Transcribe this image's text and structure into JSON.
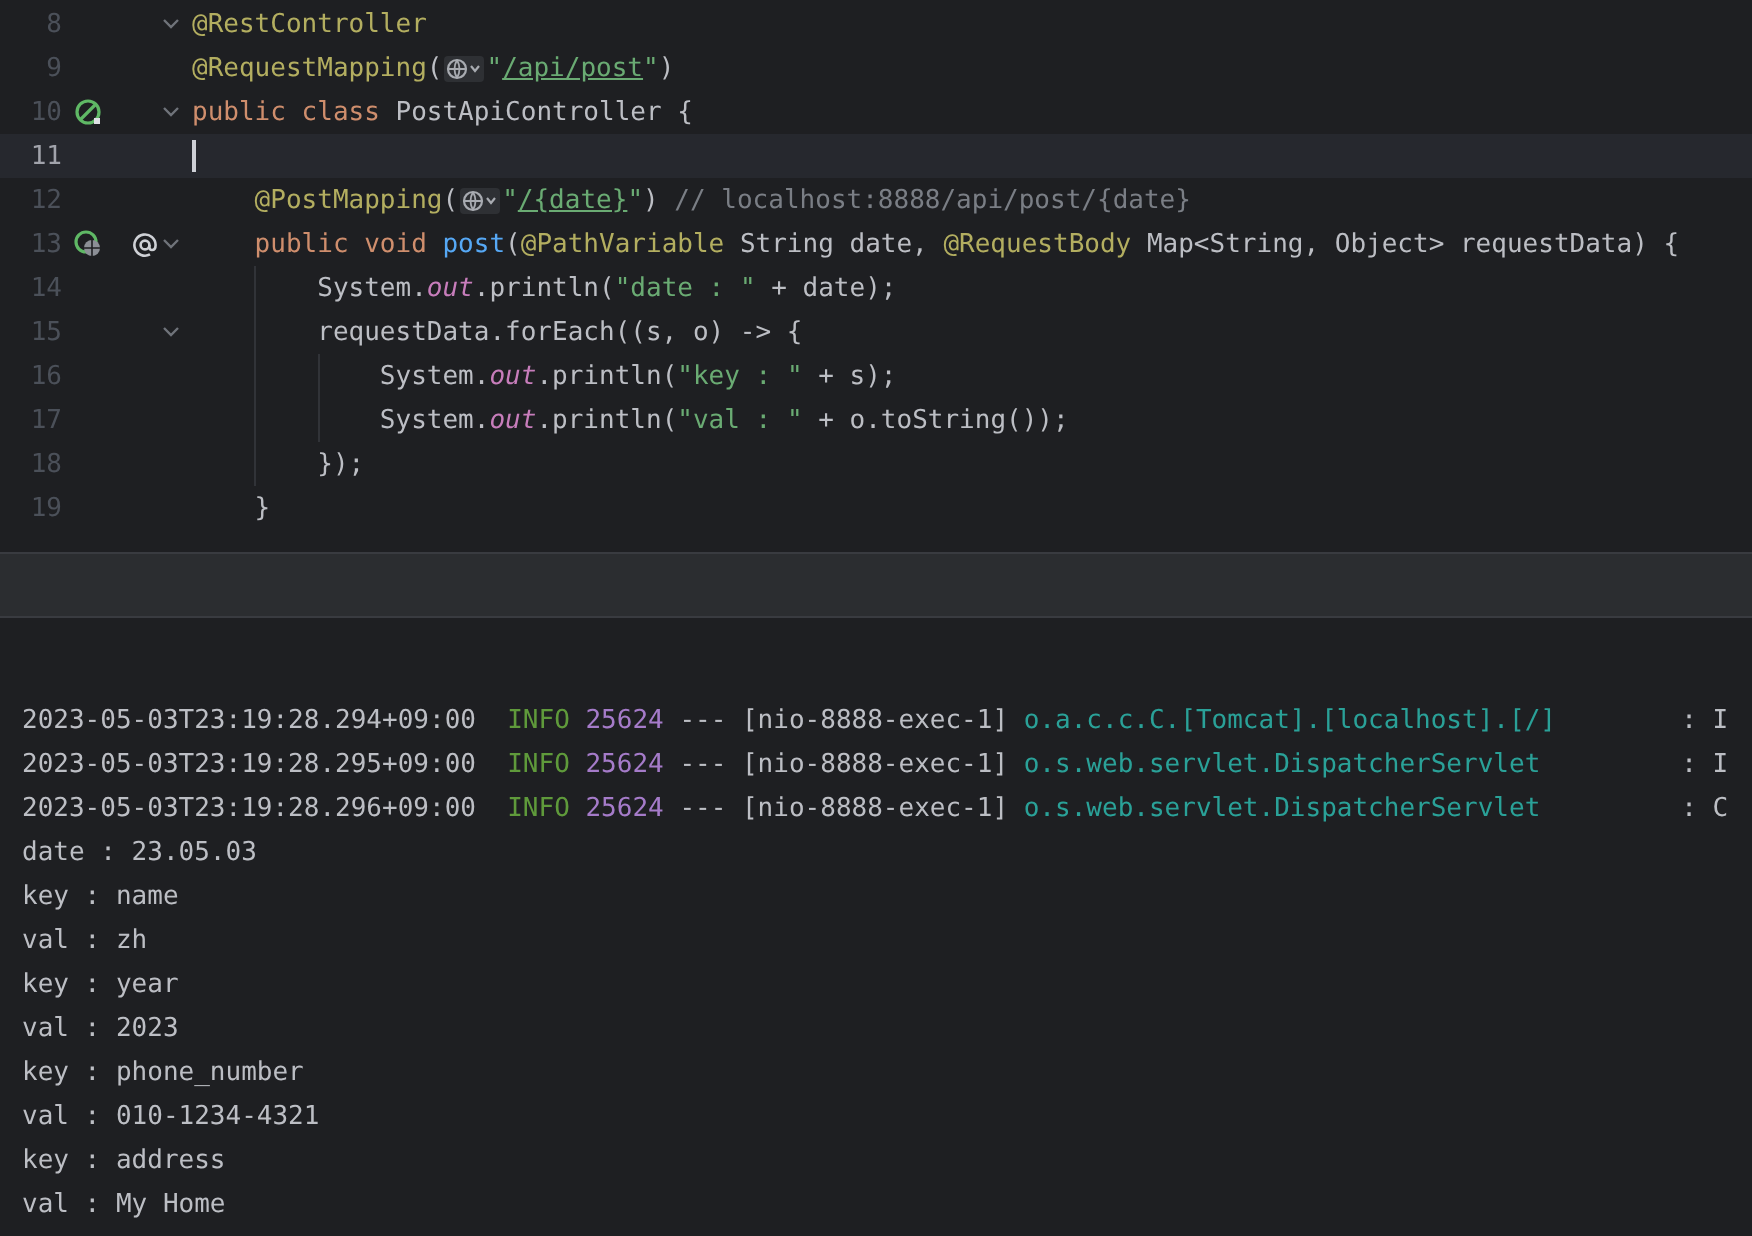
{
  "editor": {
    "lines": [
      {
        "number": "8",
        "current": false,
        "foldable": true,
        "tokens": [
          {
            "kind": "annotation",
            "text": "@RestController"
          }
        ]
      },
      {
        "number": "9",
        "current": false,
        "foldable": false,
        "tokens": [
          {
            "kind": "annotation",
            "text": "@RequestMapping"
          },
          {
            "kind": "plain",
            "text": "("
          },
          {
            "kind": "inlay"
          },
          {
            "kind": "string",
            "text": "\""
          },
          {
            "kind": "url",
            "text": "/api/post"
          },
          {
            "kind": "string",
            "text": "\""
          },
          {
            "kind": "plain",
            "text": ")"
          }
        ]
      },
      {
        "number": "10",
        "current": false,
        "foldable": true,
        "icons": [
          {
            "kind": "bean"
          }
        ],
        "tokens": [
          {
            "kind": "keyword",
            "text": "public class "
          },
          {
            "kind": "plain",
            "text": "PostApiController {"
          }
        ]
      },
      {
        "number": "11",
        "current": true,
        "foldable": false
      },
      {
        "number": "12",
        "current": false,
        "foldable": false,
        "tokens": [
          {
            "kind": "annotation",
            "text": "    @PostMapping"
          },
          {
            "kind": "plain",
            "text": "("
          },
          {
            "kind": "inlay"
          },
          {
            "kind": "string",
            "text": "\""
          },
          {
            "kind": "url",
            "text": "/{date}"
          },
          {
            "kind": "string",
            "text": "\""
          },
          {
            "kind": "plain",
            "text": ") "
          },
          {
            "kind": "comment",
            "text": "// localhost:8888/api/post/{date}"
          }
        ]
      },
      {
        "number": "13",
        "current": false,
        "foldable": true,
        "icons": [
          {
            "kind": "bean-web"
          },
          {
            "kind": "at"
          }
        ],
        "tokens": [
          {
            "kind": "keyword",
            "text": "    public void "
          },
          {
            "kind": "method",
            "text": "post"
          },
          {
            "kind": "plain",
            "text": "("
          },
          {
            "kind": "annotation",
            "text": "@PathVariable"
          },
          {
            "kind": "plain",
            "text": " String date, "
          },
          {
            "kind": "annotation",
            "text": "@RequestBody"
          },
          {
            "kind": "plain",
            "text": " Map<String, Object> requestData) {"
          }
        ]
      },
      {
        "number": "14",
        "current": false,
        "foldable": false,
        "tokens": [
          {
            "kind": "plain",
            "text": "        System."
          },
          {
            "kind": "static",
            "text": "out"
          },
          {
            "kind": "plain",
            "text": ".println("
          },
          {
            "kind": "string",
            "text": "\"date : \""
          },
          {
            "kind": "plain",
            "text": " + date);"
          }
        ]
      },
      {
        "number": "15",
        "current": false,
        "foldable": true,
        "tokens": [
          {
            "kind": "plain",
            "text": "        requestData.forEach((s, o) -> {"
          }
        ]
      },
      {
        "number": "16",
        "current": false,
        "foldable": false,
        "tokens": [
          {
            "kind": "plain",
            "text": "            System."
          },
          {
            "kind": "static",
            "text": "out"
          },
          {
            "kind": "plain",
            "text": ".println("
          },
          {
            "kind": "string",
            "text": "\"key : \""
          },
          {
            "kind": "plain",
            "text": " + s);"
          }
        ]
      },
      {
        "number": "17",
        "current": false,
        "foldable": false,
        "tokens": [
          {
            "kind": "plain",
            "text": "            System."
          },
          {
            "kind": "static",
            "text": "out"
          },
          {
            "kind": "plain",
            "text": ".println("
          },
          {
            "kind": "string",
            "text": "\"val : \""
          },
          {
            "kind": "plain",
            "text": " + o.toString());"
          }
        ]
      },
      {
        "number": "18",
        "current": false,
        "foldable": false,
        "tokens": [
          {
            "kind": "plain",
            "text": "        });"
          }
        ]
      },
      {
        "number": "19",
        "current": false,
        "foldable": false,
        "tokens": [
          {
            "kind": "plain",
            "text": "    }"
          }
        ]
      }
    ]
  },
  "console": {
    "lines": [
      {
        "kind": "log",
        "timestamp": "2023-05-03T23:19:28.294+09:00",
        "level": "INFO",
        "pid": "25624",
        "separator": "---",
        "thread": "[nio-8888-exec-1]",
        "logger": "o.a.c.c.C.[Tomcat].[localhost].[/]",
        "tail": ": I"
      },
      {
        "kind": "log",
        "timestamp": "2023-05-03T23:19:28.295+09:00",
        "level": "INFO",
        "pid": "25624",
        "separator": "---",
        "thread": "[nio-8888-exec-1]",
        "logger": "o.s.web.servlet.DispatcherServlet",
        "tail": ": I"
      },
      {
        "kind": "log",
        "timestamp": "2023-05-03T23:19:28.296+09:00",
        "level": "INFO",
        "pid": "25624",
        "separator": "---",
        "thread": "[nio-8888-exec-1]",
        "logger": "o.s.web.servlet.DispatcherServlet",
        "tail": ": C"
      },
      {
        "kind": "out",
        "text": "date : 23.05.03"
      },
      {
        "kind": "out",
        "text": "key : name"
      },
      {
        "kind": "out",
        "text": "val : zh"
      },
      {
        "kind": "out",
        "text": "key : year"
      },
      {
        "kind": "out",
        "text": "val : 2023"
      },
      {
        "kind": "out",
        "text": "key : phone_number"
      },
      {
        "kind": "out",
        "text": "val : 010-1234-4321"
      },
      {
        "kind": "out",
        "text": "key : address"
      },
      {
        "kind": "out",
        "text": "val : My Home"
      }
    ]
  }
}
